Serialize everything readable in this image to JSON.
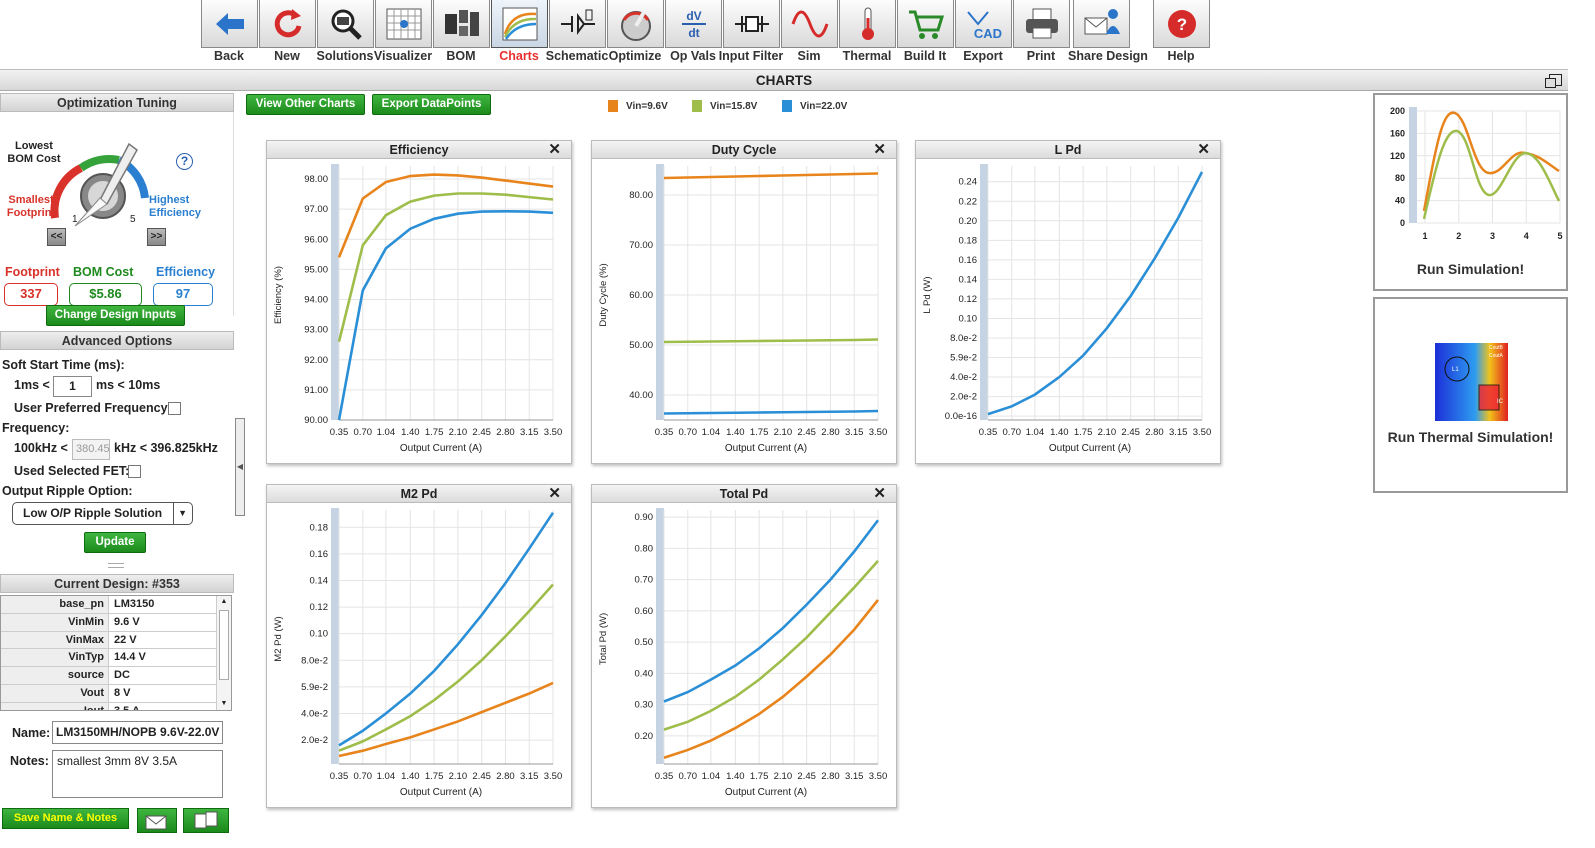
{
  "toolbar": {
    "items": [
      {
        "id": "back",
        "label": "Back",
        "icon": "back-arrow-icon"
      },
      {
        "id": "new",
        "label": "New",
        "icon": "refresh-icon"
      },
      {
        "id": "solutions",
        "label": "Solutions",
        "icon": "magnifier-chip-icon"
      },
      {
        "id": "visualizer",
        "label": "Visualizer",
        "icon": "grid-visualizer-icon"
      },
      {
        "id": "bom",
        "label": "BOM",
        "icon": "components-icon"
      },
      {
        "id": "charts",
        "label": "Charts",
        "icon": "chart-lines-icon",
        "active": true
      },
      {
        "id": "schematic",
        "label": "Schematic",
        "icon": "schematic-icon"
      },
      {
        "id": "optimize",
        "label": "Optimize",
        "icon": "dial-icon"
      },
      {
        "id": "opvals",
        "label": "Op Vals",
        "icon": "dvdt-icon"
      },
      {
        "id": "inputfilter",
        "label": "Input Filter",
        "icon": "filter-circuit-icon"
      },
      {
        "id": "sim",
        "label": "Sim",
        "icon": "sine-wave-icon"
      },
      {
        "id": "thermal",
        "label": "Thermal",
        "icon": "thermometer-icon"
      },
      {
        "id": "buildit",
        "label": "Build It",
        "icon": "cart-icon"
      },
      {
        "id": "export",
        "label": "Export",
        "icon": "cad-icon"
      },
      {
        "id": "print",
        "label": "Print",
        "icon": "printer-icon"
      },
      {
        "id": "share",
        "label": "Share Design",
        "icon": "share-person-icon"
      },
      {
        "id": "help",
        "label": "Help",
        "icon": "help-icon"
      }
    ]
  },
  "page_title": "CHARTS",
  "optimization": {
    "title": "Optimization Tuning",
    "lowest": "Lowest\nBOM Cost",
    "smallest": "Smallest\nFootprint",
    "highest": "Highest\nEfficiency",
    "knob_min": "1",
    "knob_max": "5",
    "prev": "<<",
    "next": ">>",
    "footprint_label": "Footprint",
    "footprint_value": "337",
    "bom_label": "BOM Cost",
    "bom_value": "$5.86",
    "eff_label": "Efficiency",
    "eff_value": "97"
  },
  "change_inputs": "Change Design Inputs",
  "advanced": {
    "title": "Advanced Options",
    "soft_start": "Soft Start Time (ms):",
    "ss_min": "1ms <",
    "ss_value": "1",
    "ss_max": "ms < 10ms",
    "user_freq": "User Preferred Frequency:",
    "frequency": "Frequency:",
    "f_min": "100kHz <",
    "f_value": "380.45",
    "f_max": "kHz < 396.825kHz",
    "used_fet": "Used Selected FET:",
    "ripple_label": "Output Ripple Option:",
    "ripple_value": "Low O/P Ripple Solution",
    "update": "Update"
  },
  "current_design": {
    "title": "Current Design: #353",
    "rows": [
      {
        "k": "base_pn",
        "v": "LM3150"
      },
      {
        "k": "VinMin",
        "v": "9.6 V"
      },
      {
        "k": "VinMax",
        "v": "22 V"
      },
      {
        "k": "VinTyp",
        "v": "14.4 V"
      },
      {
        "k": "source",
        "v": "DC"
      },
      {
        "k": "Vout",
        "v": "8 V"
      },
      {
        "k": "Iout",
        "v": "3.5 A"
      }
    ]
  },
  "name_label": "Name:",
  "name_value": "LM3150MH/NOPB 9.6V-22.0V",
  "notes_label": "Notes:",
  "notes_value": "smallest 3mm 8V 3.5A",
  "save_btn": "Save Name & Notes",
  "view_other": "View Other Charts",
  "export_dp": "Export DataPoints",
  "colors": {
    "vin96": "#e8841c",
    "vin158": "#9ebd4a",
    "vin22": "#2a8fd6"
  },
  "run_sim": "Run Simulation!",
  "run_thermal": "Run Thermal Simulation!",
  "thermal_labels": {
    "l1": "L1",
    "ic": "IC",
    "couta": "CoutA",
    "coutb": "CoutB"
  },
  "sim_thumb": {
    "y_ticks": [
      "200",
      "160",
      "120",
      "80",
      "40",
      "0"
    ],
    "x_ticks": [
      "1",
      "2",
      "3",
      "4",
      "5"
    ]
  },
  "chart_data": [
    {
      "type": "line",
      "title": "Efficiency",
      "xlabel": "Output Current (A)",
      "ylabel": "Efficiency (%)",
      "ylim": [
        90,
        98.3
      ],
      "x": [
        0.35,
        0.7,
        1.04,
        1.4,
        1.75,
        2.1,
        2.45,
        2.8,
        3.15,
        3.5
      ],
      "x_ticks": [
        "0.35",
        "0.70",
        "1.04",
        "1.40",
        "1.75",
        "2.10",
        "2.45",
        "2.80",
        "3.15",
        "3.50"
      ],
      "y_ticks": [
        {
          "v": 90,
          "t": "90.00"
        },
        {
          "v": 91,
          "t": "91.00"
        },
        {
          "v": 92,
          "t": "92.00"
        },
        {
          "v": 93,
          "t": "93.00"
        },
        {
          "v": 94,
          "t": "94.00"
        },
        {
          "v": 95,
          "t": "95.00"
        },
        {
          "v": 96,
          "t": "96.00"
        },
        {
          "v": 97,
          "t": "97.00"
        },
        {
          "v": 98,
          "t": "98.00"
        }
      ],
      "series": [
        {
          "name": "Vin=9.6V",
          "values": [
            95.4,
            97.35,
            97.9,
            98.1,
            98.15,
            98.12,
            98.05,
            97.95,
            97.85,
            97.75
          ]
        },
        {
          "name": "Vin=15.8V",
          "values": [
            92.6,
            95.8,
            96.8,
            97.25,
            97.45,
            97.52,
            97.52,
            97.48,
            97.4,
            97.32
          ]
        },
        {
          "name": "Vin=22.0V",
          "values": [
            90.0,
            94.3,
            95.7,
            96.35,
            96.68,
            96.85,
            96.92,
            96.93,
            96.92,
            96.88
          ]
        }
      ]
    },
    {
      "type": "line",
      "title": "Duty Cycle",
      "xlabel": "Output Current (A)",
      "ylabel": "Duty Cycle (%)",
      "ylim": [
        35,
        85
      ],
      "x": [
        0.35,
        0.7,
        1.04,
        1.4,
        1.75,
        2.1,
        2.45,
        2.8,
        3.15,
        3.5
      ],
      "x_ticks": [
        "0.35",
        "0.70",
        "1.04",
        "1.40",
        "1.75",
        "2.10",
        "2.45",
        "2.80",
        "3.15",
        "3.50"
      ],
      "y_ticks": [
        {
          "v": 40,
          "t": "40.00"
        },
        {
          "v": 50,
          "t": "50.00"
        },
        {
          "v": 60,
          "t": "60.00"
        },
        {
          "v": 70,
          "t": "70.00"
        },
        {
          "v": 80,
          "t": "80.00"
        }
      ],
      "series": [
        {
          "name": "Vin=9.6V",
          "values": [
            83.4,
            83.5,
            83.6,
            83.7,
            83.8,
            83.9,
            84.0,
            84.1,
            84.2,
            84.3
          ]
        },
        {
          "name": "Vin=15.8V",
          "values": [
            50.6,
            50.65,
            50.7,
            50.75,
            50.8,
            50.85,
            50.9,
            50.95,
            51.0,
            51.1
          ]
        },
        {
          "name": "Vin=22.0V",
          "values": [
            36.3,
            36.35,
            36.4,
            36.45,
            36.5,
            36.55,
            36.6,
            36.65,
            36.7,
            36.8
          ]
        }
      ]
    },
    {
      "type": "line",
      "title": "L Pd",
      "xlabel": "Output Current (A)",
      "ylabel": "L Pd (W)",
      "ylim": [
        -0.004,
        0.252
      ],
      "x": [
        0.35,
        0.7,
        1.04,
        1.4,
        1.75,
        2.1,
        2.45,
        2.8,
        3.15,
        3.5
      ],
      "x_ticks": [
        "0.35",
        "0.70",
        "1.04",
        "1.40",
        "1.75",
        "2.10",
        "2.45",
        "2.80",
        "3.15",
        "3.50"
      ],
      "y_ticks": [
        {
          "v": 0,
          "t": "0.0e-16"
        },
        {
          "v": 0.02,
          "t": "2.0e-2"
        },
        {
          "v": 0.04,
          "t": "4.0e-2"
        },
        {
          "v": 0.06,
          "t": "5.9e-2"
        },
        {
          "v": 0.08,
          "t": "8.0e-2"
        },
        {
          "v": 0.1,
          "t": "0.10"
        },
        {
          "v": 0.12,
          "t": "0.12"
        },
        {
          "v": 0.14,
          "t": "0.14"
        },
        {
          "v": 0.16,
          "t": "0.16"
        },
        {
          "v": 0.18,
          "t": "0.18"
        },
        {
          "v": 0.2,
          "t": "0.20"
        },
        {
          "v": 0.22,
          "t": "0.22"
        },
        {
          "v": 0.24,
          "t": "0.24"
        }
      ],
      "series": [
        {
          "name": "Vin=22.0V",
          "values": [
            0.002,
            0.01,
            0.022,
            0.04,
            0.062,
            0.09,
            0.123,
            0.161,
            0.203,
            0.25
          ]
        }
      ]
    },
    {
      "type": "line",
      "title": "M2 Pd",
      "xlabel": "Output Current (A)",
      "ylabel": "M2 Pd (W)",
      "ylim": [
        0.002,
        0.19
      ],
      "x": [
        0.35,
        0.7,
        1.04,
        1.4,
        1.75,
        2.1,
        2.45,
        2.8,
        3.15,
        3.5
      ],
      "x_ticks": [
        "0.35",
        "0.70",
        "1.04",
        "1.40",
        "1.75",
        "2.10",
        "2.45",
        "2.80",
        "3.15",
        "3.50"
      ],
      "y_ticks": [
        {
          "v": 0.02,
          "t": "2.0e-2"
        },
        {
          "v": 0.04,
          "t": "4.0e-2"
        },
        {
          "v": 0.06,
          "t": "5.9e-2"
        },
        {
          "v": 0.08,
          "t": "8.0e-2"
        },
        {
          "v": 0.1,
          "t": "0.10"
        },
        {
          "v": 0.12,
          "t": "0.12"
        },
        {
          "v": 0.14,
          "t": "0.14"
        },
        {
          "v": 0.16,
          "t": "0.16"
        },
        {
          "v": 0.18,
          "t": "0.18"
        }
      ],
      "series": [
        {
          "name": "Vin=9.6V",
          "values": [
            0.008,
            0.012,
            0.017,
            0.022,
            0.028,
            0.034,
            0.041,
            0.048,
            0.055,
            0.063
          ]
        },
        {
          "name": "Vin=15.8V",
          "values": [
            0.012,
            0.019,
            0.028,
            0.038,
            0.05,
            0.064,
            0.08,
            0.098,
            0.117,
            0.137
          ]
        },
        {
          "name": "Vin=22.0V",
          "values": [
            0.016,
            0.027,
            0.04,
            0.055,
            0.072,
            0.092,
            0.114,
            0.138,
            0.164,
            0.191
          ]
        }
      ]
    },
    {
      "type": "line",
      "title": "Total Pd",
      "xlabel": "Output Current (A)",
      "ylabel": "Total Pd (W)",
      "ylim": [
        0.11,
        0.91
      ],
      "x": [
        0.35,
        0.7,
        1.04,
        1.4,
        1.75,
        2.1,
        2.45,
        2.8,
        3.15,
        3.5
      ],
      "x_ticks": [
        "0.35",
        "0.70",
        "1.04",
        "1.40",
        "1.75",
        "2.10",
        "2.45",
        "2.80",
        "3.15",
        "3.50"
      ],
      "y_ticks": [
        {
          "v": 0.2,
          "t": "0.20"
        },
        {
          "v": 0.3,
          "t": "0.30"
        },
        {
          "v": 0.4,
          "t": "0.40"
        },
        {
          "v": 0.5,
          "t": "0.50"
        },
        {
          "v": 0.6,
          "t": "0.60"
        },
        {
          "v": 0.7,
          "t": "0.70"
        },
        {
          "v": 0.8,
          "t": "0.80"
        },
        {
          "v": 0.9,
          "t": "0.90"
        }
      ],
      "series": [
        {
          "name": "Vin=9.6V",
          "values": [
            0.13,
            0.155,
            0.185,
            0.225,
            0.27,
            0.325,
            0.39,
            0.46,
            0.54,
            0.635
          ]
        },
        {
          "name": "Vin=15.8V",
          "values": [
            0.22,
            0.245,
            0.28,
            0.325,
            0.38,
            0.445,
            0.515,
            0.595,
            0.675,
            0.76
          ]
        },
        {
          "name": "Vin=22.0V",
          "values": [
            0.31,
            0.34,
            0.38,
            0.425,
            0.48,
            0.545,
            0.62,
            0.7,
            0.79,
            0.89
          ]
        }
      ]
    }
  ],
  "legend": [
    {
      "name": "Vin=9.6V",
      "color": "#e8841c"
    },
    {
      "name": "Vin=15.8V",
      "color": "#9ebd4a"
    },
    {
      "name": "Vin=22.0V",
      "color": "#2a8fd6"
    }
  ]
}
